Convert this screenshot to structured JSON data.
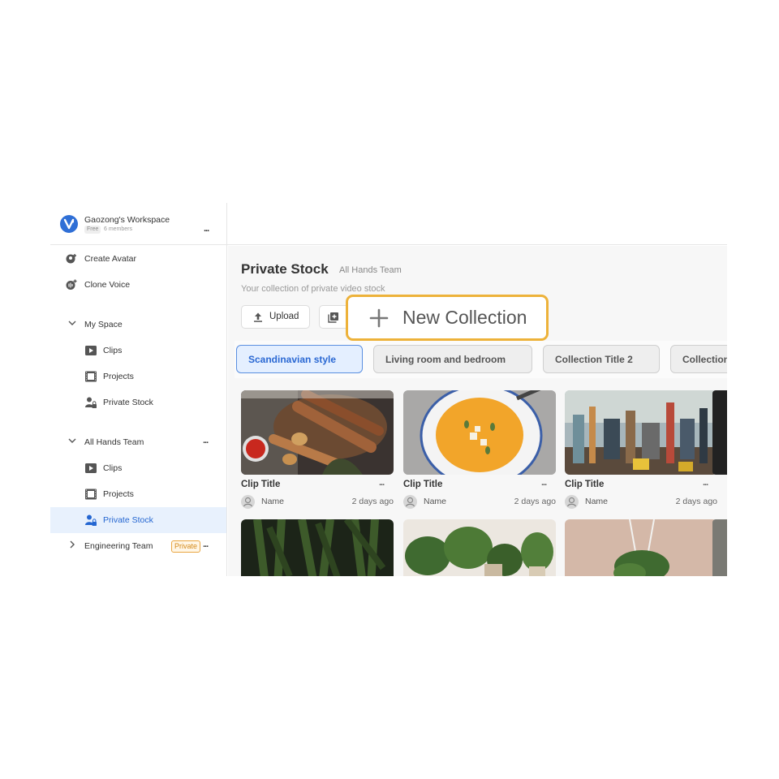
{
  "workspace": {
    "name": "Gaozong's Workspace",
    "plan": "Free",
    "members": "6 members",
    "more": "..."
  },
  "sidebar": {
    "top_items": [
      {
        "label": "Create Avatar",
        "icon": "create-avatar-icon"
      },
      {
        "label": "Clone Voice",
        "icon": "clone-voice-icon"
      }
    ],
    "my_space": {
      "label": "My Space",
      "items": [
        {
          "label": "Clips",
          "icon": "clips-icon"
        },
        {
          "label": "Projects",
          "icon": "projects-icon"
        },
        {
          "label": "Private Stock",
          "icon": "private-stock-icon"
        }
      ]
    },
    "team": {
      "label": "All Hands Team",
      "more": "...",
      "items": [
        {
          "label": "Clips",
          "icon": "clips-icon"
        },
        {
          "label": "Projects",
          "icon": "projects-icon"
        },
        {
          "label": "Private Stock",
          "icon": "private-stock-icon",
          "active": true
        }
      ]
    },
    "engineering": {
      "label": "Engineering Team",
      "badge": "Private",
      "more": "..."
    }
  },
  "main": {
    "title": "Private Stock",
    "team": "All Hands Team",
    "subtitle": "Your collection of private video stock",
    "upload_label": "Upload",
    "new_collection_label": "New Collection",
    "collections": [
      {
        "label": "Scandinavian style",
        "selected": true
      },
      {
        "label": "Living room and bedroom",
        "selected": false
      },
      {
        "label": "Collection Title 2",
        "selected": false
      },
      {
        "label": "Collection",
        "selected": false
      }
    ],
    "clips": [
      {
        "title": "Clip Title",
        "owner": "Name",
        "date": "2 days ago",
        "more": "..."
      },
      {
        "title": "Clip Title",
        "owner": "Name",
        "date": "2 days ago",
        "more": "..."
      },
      {
        "title": "Clip Title",
        "owner": "Name",
        "date": "2 days ago",
        "more": "..."
      }
    ]
  },
  "colors": {
    "accent": "#2f6fd6",
    "active_bg": "#e8f1fd",
    "highlight": "#edb23a",
    "private_badge": "#e9a540"
  }
}
